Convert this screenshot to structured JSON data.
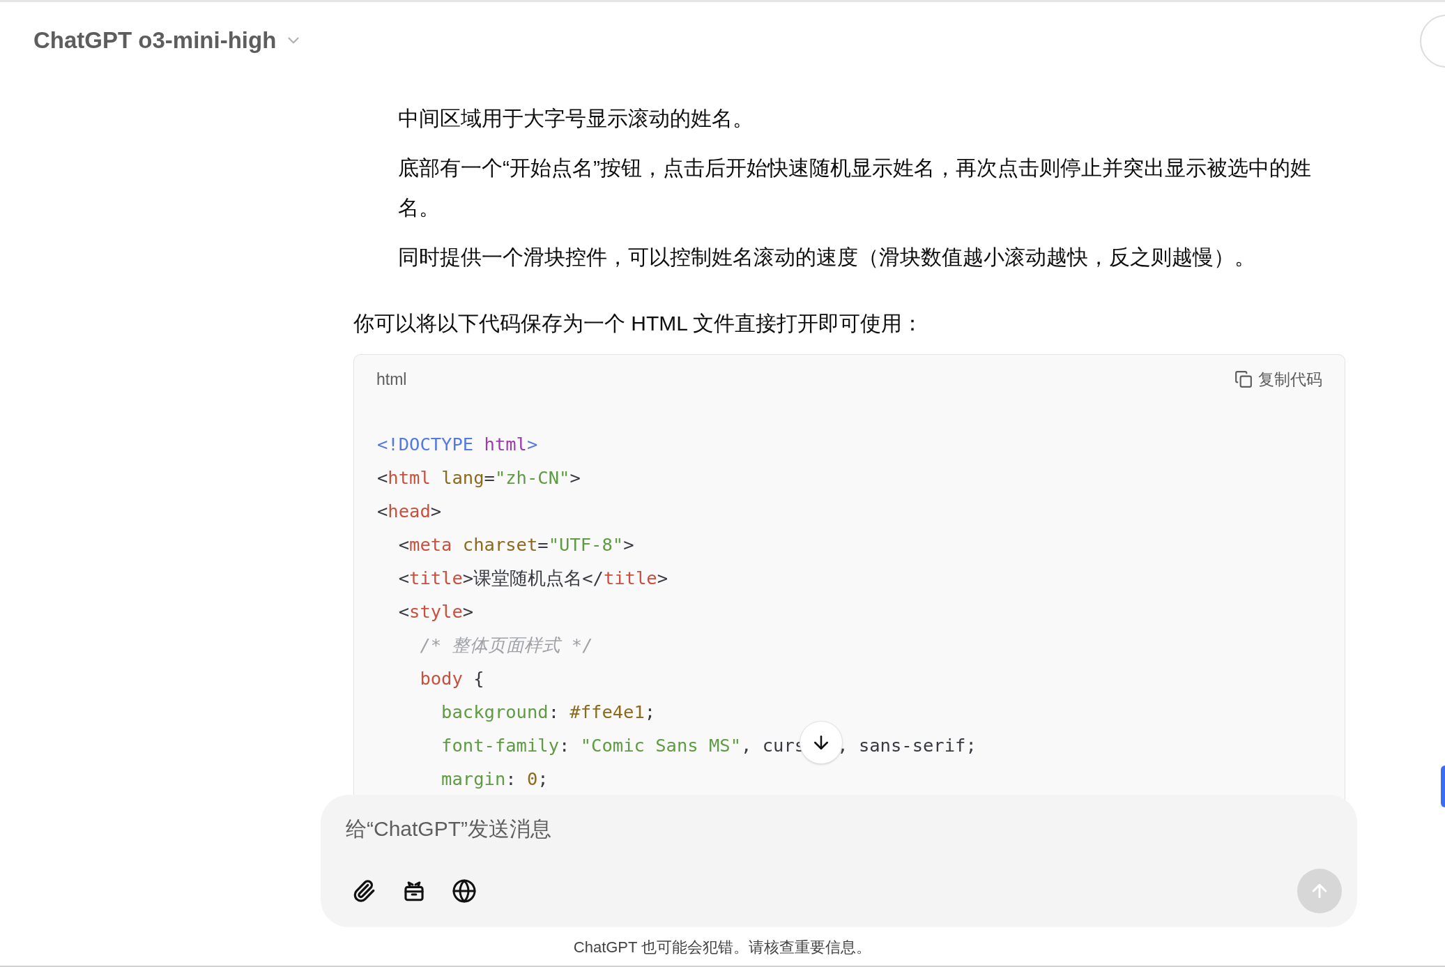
{
  "header": {
    "title": "ChatGPT o3-mini-high"
  },
  "list_items": [
    "中间区域用于大字号显示滚动的姓名。",
    "底部有一个“开始点名”按钮，点击后开始快速随机显示姓名，再次点击则停止并突出显示被选中的姓名。",
    "同时提供一个滑块控件，可以控制姓名滚动的速度（滑块数值越小滚动越快，反之则越慢）。"
  ],
  "intro": "你可以将以下代码保存为一个 HTML 文件直接打开即可使用：",
  "code_block": {
    "language": "html",
    "copy_label": "复制代码",
    "lines": [
      [
        {
          "kind": "doctype",
          "text": "<!DOCTYPE "
        },
        {
          "kind": "keyword",
          "text": "html"
        },
        {
          "kind": "doctype",
          "text": ">"
        }
      ],
      [
        {
          "kind": "punct",
          "text": "<"
        },
        {
          "kind": "tag",
          "text": "html"
        },
        {
          "kind": "attr",
          "text": " lang"
        },
        {
          "kind": "punct",
          "text": "="
        },
        {
          "kind": "string",
          "text": "\"zh-CN\""
        },
        {
          "kind": "punct",
          "text": ">"
        }
      ],
      [
        {
          "kind": "punct",
          "text": "<"
        },
        {
          "kind": "tag",
          "text": "head"
        },
        {
          "kind": "punct",
          "text": ">"
        }
      ],
      [
        {
          "kind": "punct",
          "text": "  <"
        },
        {
          "kind": "tag",
          "text": "meta"
        },
        {
          "kind": "attr",
          "text": " charset"
        },
        {
          "kind": "punct",
          "text": "="
        },
        {
          "kind": "string",
          "text": "\"UTF-8\""
        },
        {
          "kind": "punct",
          "text": ">"
        }
      ],
      [
        {
          "kind": "punct",
          "text": "  <"
        },
        {
          "kind": "tag",
          "text": "title"
        },
        {
          "kind": "punct",
          "text": ">课堂随机点名</"
        },
        {
          "kind": "tag",
          "text": "title"
        },
        {
          "kind": "punct",
          "text": ">"
        }
      ],
      [
        {
          "kind": "punct",
          "text": "  <"
        },
        {
          "kind": "tag",
          "text": "style"
        },
        {
          "kind": "punct",
          "text": ">"
        }
      ],
      [
        {
          "kind": "comment",
          "text": "    /* 整体页面样式 */"
        }
      ],
      [
        {
          "kind": "tag",
          "text": "    body"
        },
        {
          "kind": "punct",
          "text": " {"
        }
      ],
      [
        {
          "kind": "property",
          "text": "      background"
        },
        {
          "kind": "punct",
          "text": ": "
        },
        {
          "kind": "value",
          "text": "#ffe4e1"
        },
        {
          "kind": "punct",
          "text": ";"
        }
      ],
      [
        {
          "kind": "property",
          "text": "      font-family"
        },
        {
          "kind": "punct",
          "text": ": "
        },
        {
          "kind": "string",
          "text": "\"Comic Sans MS\""
        },
        {
          "kind": "punct",
          "text": ", curs"
        },
        {
          "kind": "covered"
        },
        {
          "kind": "punct",
          "text": ", sans-serif;"
        }
      ],
      [
        {
          "kind": "property",
          "text": "      margin"
        },
        {
          "kind": "punct",
          "text": ": "
        },
        {
          "kind": "value",
          "text": "0"
        },
        {
          "kind": "punct",
          "text": ";"
        }
      ]
    ]
  },
  "composer": {
    "placeholder": "给“ChatGPT”发送消息"
  },
  "footer": "ChatGPT 也可能会犯错。请核查重要信息。"
}
